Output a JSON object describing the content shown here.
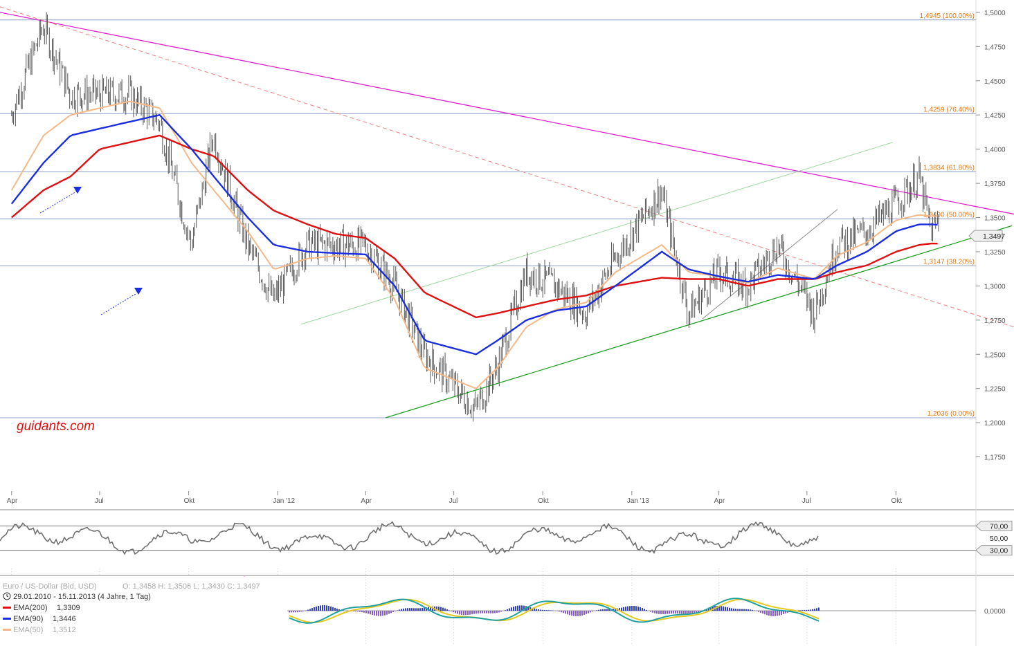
{
  "watermark": "guidants.com",
  "legend": {
    "instrument": "Euro / US-Dollar (Bid, USD)",
    "ohlc": "O: 1,3458  H: 1,3506  L: 1,3430  C: 1,3497",
    "range": "29.01.2010 - 15.11.2013 (4 Jahre, 1 Tag)",
    "ema200_label": "EMA(200)",
    "ema200_value": "1,3309",
    "ema90_label": "EMA(90)",
    "ema90_value": "1,3446",
    "ema50_label": "EMA(50)",
    "ema50_value": "1,3512"
  },
  "last_price_tag": "1,3497",
  "rsi_labels": {
    "upper": "70,00",
    "mid": "50,00",
    "lower": "30,00"
  },
  "macd_label": "0,0000",
  "colors": {
    "ema200": "#e01010",
    "ema90": "#1a2ee0",
    "ema50": "#f5b887",
    "downtrend": "#e020d0",
    "uptrend": "#20a020",
    "fib": "#e07a10",
    "rsi": "#707070"
  },
  "chart_data": {
    "type": "line",
    "title": "",
    "xlabel": "",
    "ylabel": "",
    "ylim": [
      1.15,
      1.505
    ],
    "ytick_labels": [
      "1,5000",
      "1,4750",
      "1,4500",
      "1,4250",
      "1,4000",
      "1,3750",
      "1,3500",
      "1,3250",
      "1,3000",
      "1,2750",
      "1,2500",
      "1,2250",
      "1,2000",
      "1,1750"
    ],
    "yticks": [
      1.5,
      1.475,
      1.45,
      1.425,
      1.4,
      1.375,
      1.35,
      1.325,
      1.3,
      1.275,
      1.25,
      1.225,
      1.2,
      1.175
    ],
    "xtick_labels": [
      "Apr",
      "Jul",
      "Okt",
      "Jan '12",
      "Apr",
      "Jul",
      "Okt",
      "Jan '13",
      "Apr",
      "Jul",
      "Okt"
    ],
    "xtick_dates": [
      "2011-04",
      "2011-07",
      "2011-10",
      "2012-01",
      "2012-04",
      "2012-07",
      "2012-10",
      "2013-01",
      "2013-04",
      "2013-07",
      "2013-10"
    ],
    "fib_levels": [
      {
        "value": 1.4945,
        "label": "1,4945 (100.00%)"
      },
      {
        "value": 1.4259,
        "label": "1,4259 (76.40%)"
      },
      {
        "value": 1.3834,
        "label": "1,3834 (61.80%)"
      },
      {
        "value": 1.349,
        "label": "1,3490 (50.00%)"
      },
      {
        "value": 1.3147,
        "label": "1,3147 (38.20%)"
      },
      {
        "value": 1.2036,
        "label": "1,2036 (0.00%)"
      }
    ],
    "x": [
      "2011-04-01",
      "2011-05-04",
      "2011-06-01",
      "2011-07-01",
      "2011-08-01",
      "2011-09-01",
      "2011-10-04",
      "2011-10-27",
      "2011-12-01",
      "2011-12-28",
      "2012-02-01",
      "2012-03-01",
      "2012-04-01",
      "2012-05-01",
      "2012-06-01",
      "2012-07-24",
      "2012-08-15",
      "2012-09-14",
      "2012-10-15",
      "2012-11-15",
      "2012-12-15",
      "2013-02-01",
      "2013-03-01",
      "2013-04-01",
      "2013-05-01",
      "2013-06-01",
      "2013-07-09",
      "2013-08-01",
      "2013-09-01",
      "2013-10-01",
      "2013-10-25",
      "2013-11-07",
      "2013-11-15"
    ],
    "series": [
      {
        "name": "Euro / US-Dollar (Bid, USD)",
        "values": [
          1.425,
          1.49,
          1.44,
          1.44,
          1.44,
          1.42,
          1.33,
          1.41,
          1.33,
          1.29,
          1.33,
          1.33,
          1.33,
          1.3,
          1.25,
          1.21,
          1.24,
          1.31,
          1.3,
          1.28,
          1.32,
          1.37,
          1.28,
          1.31,
          1.3,
          1.33,
          1.28,
          1.33,
          1.34,
          1.36,
          1.38,
          1.34,
          1.3497
        ]
      },
      {
        "name": "EMA(200)",
        "values": [
          1.35,
          1.37,
          1.38,
          1.4,
          1.405,
          1.41,
          1.4,
          1.395,
          1.37,
          1.355,
          1.345,
          1.338,
          1.335,
          1.32,
          1.295,
          1.277,
          1.28,
          1.285,
          1.29,
          1.293,
          1.3,
          1.306,
          1.305,
          1.305,
          1.3,
          1.305,
          1.305,
          1.31,
          1.315,
          1.325,
          1.33,
          1.331,
          1.3309
        ]
      },
      {
        "name": "EMA(90)",
        "values": [
          1.36,
          1.39,
          1.41,
          1.415,
          1.42,
          1.425,
          1.4,
          1.38,
          1.35,
          1.33,
          1.325,
          1.324,
          1.323,
          1.3,
          1.26,
          1.25,
          1.26,
          1.275,
          1.282,
          1.285,
          1.3,
          1.325,
          1.312,
          1.307,
          1.303,
          1.308,
          1.305,
          1.315,
          1.325,
          1.34,
          1.345,
          1.345,
          1.3446
        ]
      },
      {
        "name": "EMA(50)",
        "values": [
          1.37,
          1.41,
          1.425,
          1.43,
          1.435,
          1.43,
          1.39,
          1.37,
          1.34,
          1.312,
          1.32,
          1.322,
          1.32,
          1.29,
          1.24,
          1.225,
          1.24,
          1.27,
          1.283,
          1.288,
          1.31,
          1.33,
          1.31,
          1.307,
          1.302,
          1.313,
          1.305,
          1.322,
          1.332,
          1.348,
          1.352,
          1.351,
          1.3512
        ]
      }
    ]
  }
}
